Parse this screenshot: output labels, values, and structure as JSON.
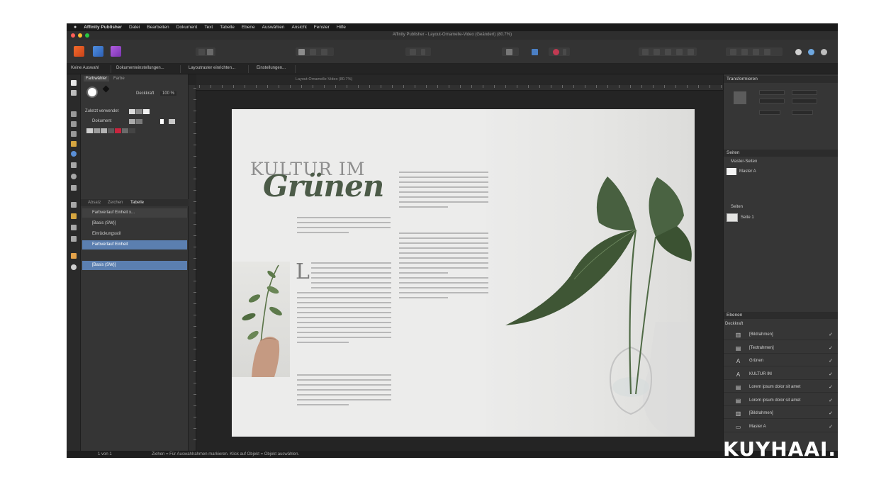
{
  "menu": {
    "apple": "",
    "items": [
      "Affinity Publisher",
      "Datei",
      "Bearbeiten",
      "Dokument",
      "Text",
      "Tabelle",
      "Ebene",
      "Auswählen",
      "Ansicht",
      "Fenster",
      "Hilfe"
    ]
  },
  "window": {
    "title": "Affinity Publisher - Layout-Ornamelle-Video (Geändert) (80.7%)"
  },
  "context_tabs": {
    "items": [
      "Keine Auswahl",
      "Dokumenteinstellungen...",
      "Layoutraster einrichten...",
      "Einstellungen..."
    ]
  },
  "doc_tab": {
    "label": "Layout-Ornamelle-Video (80.7%)"
  },
  "left_panel": {
    "tabs": [
      "Farbwähler",
      "Farbe"
    ],
    "opacity_label": "Deckkraft",
    "opacity_value": "100 %",
    "recent_label": "Zuletzt verwendet",
    "document_label": "Dokument",
    "layer_tabs": [
      "Absatz",
      "Zeichen",
      "Tabelle"
    ],
    "layers": [
      "Farbverlauf Einheit x...",
      "[Basis (SW)]",
      "Einrückungsstil",
      "Farbverlauf Einheit",
      "[Basis (SW)]"
    ]
  },
  "page_content": {
    "headline_line1": "KULTUR IM",
    "headline_line2": "Grünen",
    "dropcap": "L"
  },
  "right_panel": {
    "transform_title": "Transformieren",
    "pages_title": "Seiten",
    "master_pages_label": "Master-Seiten",
    "master_a": "Master A",
    "pages_label": "Seiten",
    "page_1": "Seite 1",
    "layers_title": "Ebenen",
    "layers_blend": "Deckkraft",
    "layer_rows": [
      {
        "icon": "picture-frame-icon",
        "label": "[Bildrahmen]"
      },
      {
        "icon": "text-frame-icon",
        "label": "[Textrahmen]"
      },
      {
        "icon": "artistic-text-icon",
        "label": "Grünen"
      },
      {
        "icon": "artistic-text-icon",
        "label": "KULTUR IM"
      },
      {
        "icon": "text-frame-icon",
        "label": "Lorem ipsum dolor sit amet"
      },
      {
        "icon": "text-frame-icon",
        "label": "Lorem ipsum dolor sit amet"
      },
      {
        "icon": "picture-frame-icon",
        "label": "[Bildrahmen]"
      },
      {
        "icon": "master-icon",
        "label": "Master A"
      }
    ]
  },
  "status": {
    "page": "1 von 1",
    "hint": "Ziehen = Für Auswahlrahmen markieren. Klick auf Objekt = Objekt auswählen."
  },
  "watermark": "KUYHAAI.ME",
  "colors": {
    "accent_blue": "#5b7fb0",
    "headline_green": "#4c5b48",
    "headline_gray": "#8d8d8d"
  }
}
